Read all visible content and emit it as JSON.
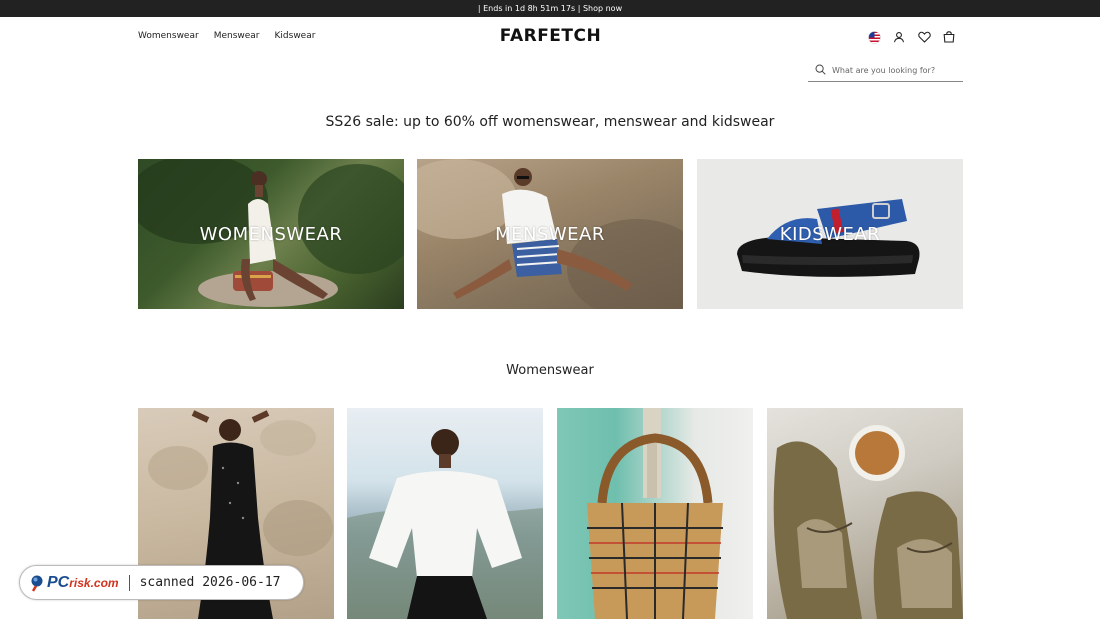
{
  "promo": {
    "text": "| Ends in 1d 8h 51m 17s | Shop now"
  },
  "nav": {
    "items": [
      {
        "label": "Womenswear"
      },
      {
        "label": "Menswear"
      },
      {
        "label": "Kidswear"
      }
    ]
  },
  "brand": {
    "logo": "FARFETCH"
  },
  "header_icons": [
    "us-flag-icon",
    "account-icon",
    "wishlist-heart-icon",
    "shopping-bag-icon"
  ],
  "search": {
    "placeholder": "What are you looking for?",
    "value": ""
  },
  "sale": {
    "headline": "SS26 sale: up to 60% off womenswear, menswear and kidswear"
  },
  "categories": [
    {
      "label": "WOMENSWEAR"
    },
    {
      "label": "MENSWEAR"
    },
    {
      "label": "KIDSWEAR"
    }
  ],
  "section": {
    "title": "Womenswear"
  },
  "products": [
    {
      "image": "model-black-sequin-dress"
    },
    {
      "image": "model-white-blouse"
    },
    {
      "image": "woven-plaid-tote-bag"
    },
    {
      "image": "olive-suede-boat-shoes"
    }
  ],
  "watermark": {
    "logo_main": "PC",
    "logo_sub": "risk.com",
    "text": "scanned 2026-06-17"
  },
  "colors": {
    "promo_bg": "#222222",
    "text": "#222222",
    "link_blue": "#1a4d8f"
  }
}
